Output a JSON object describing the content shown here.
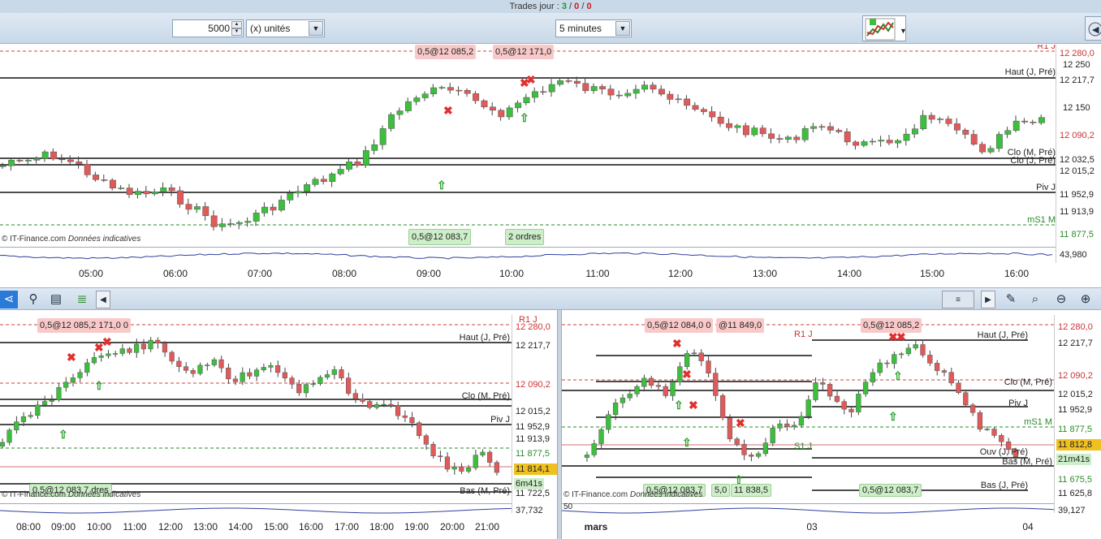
{
  "header": {
    "title_prefix": "Trades jour : ",
    "t1": "3",
    "sep1": " / ",
    "t2": "0",
    "sep2": " / ",
    "t3": "0"
  },
  "toolbar": {
    "quantity": "5000",
    "unit_select": "(x) unités",
    "interval_select": "5 minutes"
  },
  "colors": {
    "up": "#3cbf3c",
    "down": "#e05a5a",
    "accent": "#f0c020"
  },
  "copyright": {
    "brand": "© IT-Finance.com",
    "note": "Données indicatives"
  },
  "main_chart": {
    "price_labels": [
      "12 280,0",
      "12 250",
      "12 217,7",
      "12 150",
      "12 090,2",
      "12 032,5",
      "12 015,2",
      "11 952,9",
      "11 913,9",
      "11 877,5"
    ],
    "level_labels": [
      "R1 J",
      "Haut (J, Pré)",
      "Clo (M, Pré)",
      "Clo (J, Pré)",
      "Piv J",
      "mS1 M"
    ],
    "tags": [
      "0,5@12 085,2",
      "0,5@12 171,0",
      "0,5@12 083,7",
      "2 ordres"
    ],
    "xticks": [
      "05:00",
      "06:00",
      "07:00",
      "08:00",
      "09:00",
      "10:00",
      "11:00",
      "12:00",
      "13:00",
      "14:00",
      "15:00",
      "16:00"
    ],
    "indicator_value": "43,980"
  },
  "left_chart": {
    "price_labels": [
      "R1 J",
      "12 280,0",
      "12 217,7",
      "12 090,2",
      "12 015,2",
      "11 952,9",
      "11 913,9",
      "11 877,5",
      "11 814,1",
      "6m41s",
      "11 722,5",
      "37,732"
    ],
    "level_labels": [
      "Haut (J, Pré)",
      "Clo (M, Pré)",
      "Piv J",
      "Bas (M, Pré)"
    ],
    "tags": [
      "0,5@12 085,2 171,0 0",
      "0,5@12 083,7 dres"
    ],
    "xticks": [
      "08:00",
      "09:00",
      "10:00",
      "11:00",
      "12:00",
      "13:00",
      "14:00",
      "15:00",
      "16:00",
      "17:00",
      "18:00",
      "19:00",
      "20:00",
      "21:00"
    ]
  },
  "right_chart": {
    "price_labels": [
      "12 280,0",
      "12 217,7",
      "12 090,2",
      "12 015,2",
      "11 952,9",
      "11 877,5",
      "11 812,8",
      "21m41s",
      "11 675,5",
      "11 625,8",
      "39,127"
    ],
    "level_labels": [
      "R1 J",
      "Haut (J, Pré)",
      "Clo (M, Pré)",
      "Piv J",
      "mS1 M",
      "S1 J",
      "Ouv (J, Pré)",
      "Bas (M, Pré)",
      "Bas (J, Pré)"
    ],
    "tags": [
      "0,5@12 084,0 0",
      "@11 849,0",
      "0,5@12 085,2",
      "0,5@12 083,7",
      "5,0",
      "11 838,5",
      "0,5@12 083,7"
    ],
    "xticks": [
      "mars",
      "03",
      "04"
    ],
    "indicator_left": "50"
  }
}
